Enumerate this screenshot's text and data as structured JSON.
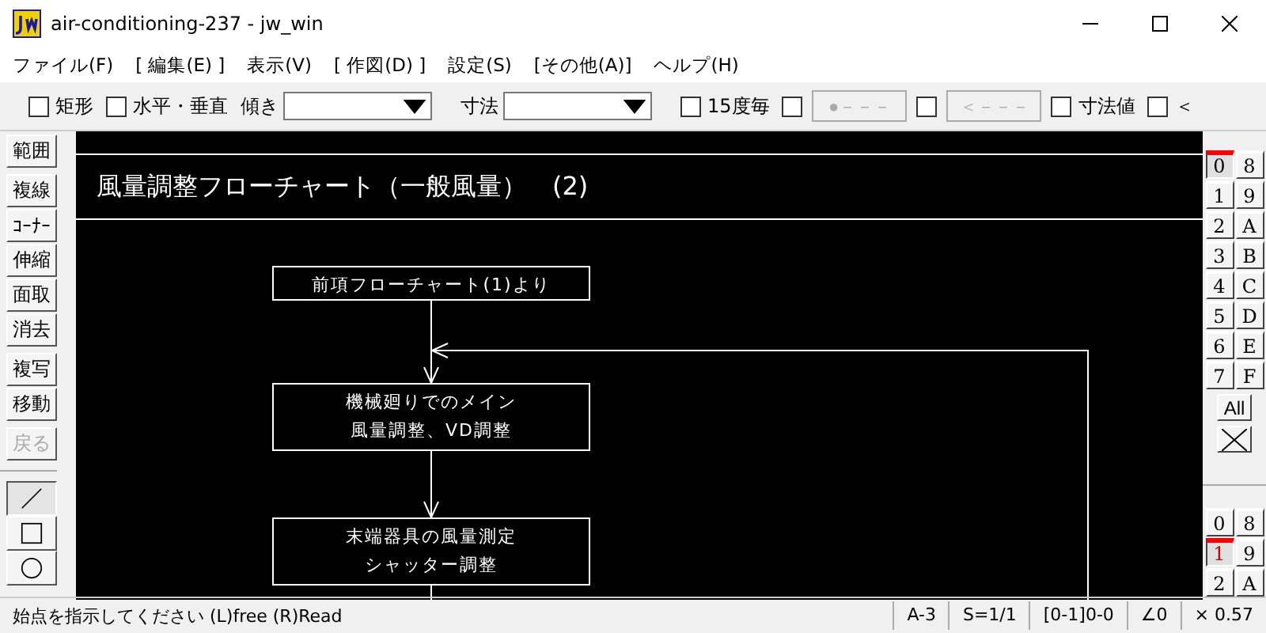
{
  "window": {
    "title": "air-conditioning-237 - jw_win"
  },
  "menu": [
    "ファイル(F)",
    "[ 編集(E) ]",
    "表示(V)",
    "[ 作図(D) ]",
    "設定(S)",
    "[その他(A)]",
    "ヘルプ(H)"
  ],
  "toolbar": [
    {
      "kind": "checkbox",
      "label": "矩形",
      "checked": false
    },
    {
      "kind": "checkbox",
      "label": "水平・垂直",
      "checked": false
    },
    {
      "kind": "combo",
      "label": "傾き"
    },
    {
      "kind": "combo",
      "label": "寸法"
    },
    {
      "kind": "checkbox",
      "label": "15度毎",
      "checked": false
    },
    {
      "kind": "checkbox",
      "checked": false
    },
    {
      "kind": "button",
      "label": "●－－－",
      "disabled": true
    },
    {
      "kind": "checkbox",
      "checked": false
    },
    {
      "kind": "button",
      "label": "＜－－－",
      "disabled": true
    },
    {
      "kind": "checkbox",
      "label": "寸法値",
      "checked": false
    },
    {
      "kind": "checkbox",
      "label": "＜",
      "checked": false
    }
  ],
  "left_tools": [
    [
      {
        "label": "範囲",
        "disabled": false
      }
    ],
    [
      {
        "label": "複線",
        "disabled": false
      },
      {
        "label": "ｺｰﾅｰ",
        "disabled": false
      },
      {
        "label": "伸縮",
        "disabled": false
      },
      {
        "label": "面取",
        "disabled": false
      },
      {
        "label": "消去",
        "disabled": false
      }
    ],
    [
      {
        "label": "複写",
        "disabled": false
      },
      {
        "label": "移動",
        "disabled": false
      }
    ],
    [
      {
        "label": "戻る",
        "disabled": true
      }
    ]
  ],
  "draw_tools": [
    {
      "kind": "line",
      "selected": true
    },
    {
      "kind": "rect",
      "selected": false
    },
    {
      "kind": "circle",
      "selected": false
    }
  ],
  "drawing": {
    "title": "風量調整フローチャート（一般風量）　(2)",
    "boxes": [
      {
        "lines": [
          "前項フローチャート(1)より"
        ]
      },
      {
        "lines": [
          "機械廻りでのメイン",
          "風量調整、VD調整"
        ]
      },
      {
        "lines": [
          "末端器具の風量測定",
          "シャッター調整"
        ]
      }
    ]
  },
  "layers": [
    {
      "label": "0",
      "selected": true
    },
    {
      "label": "8",
      "selected": false
    },
    {
      "label": "1",
      "selected": false
    },
    {
      "label": "9",
      "selected": false
    },
    {
      "label": "2",
      "selected": false
    },
    {
      "label": "A",
      "selected": false
    },
    {
      "label": "3",
      "selected": false
    },
    {
      "label": "B",
      "selected": false
    },
    {
      "label": "4",
      "selected": false
    },
    {
      "label": "C",
      "selected": false
    },
    {
      "label": "5",
      "selected": false
    },
    {
      "label": "D",
      "selected": false
    },
    {
      "label": "6",
      "selected": false
    },
    {
      "label": "E",
      "selected": false
    },
    {
      "label": "7",
      "selected": false
    },
    {
      "label": "F",
      "selected": false
    }
  ],
  "all_button": "All",
  "layer_groups": [
    {
      "label": "0",
      "selected": false
    },
    {
      "label": "8",
      "selected": false
    },
    {
      "label": "1",
      "selected": true
    },
    {
      "label": "9",
      "selected": false
    },
    {
      "label": "2",
      "selected": false
    },
    {
      "label": "A",
      "selected": false
    }
  ],
  "status_bar": {
    "message": "始点を指示してください (L)free (R)Read",
    "fields": [
      "A-3",
      "S=1/1",
      "[0-1]0-0",
      "∠0",
      "× 0.57"
    ]
  }
}
